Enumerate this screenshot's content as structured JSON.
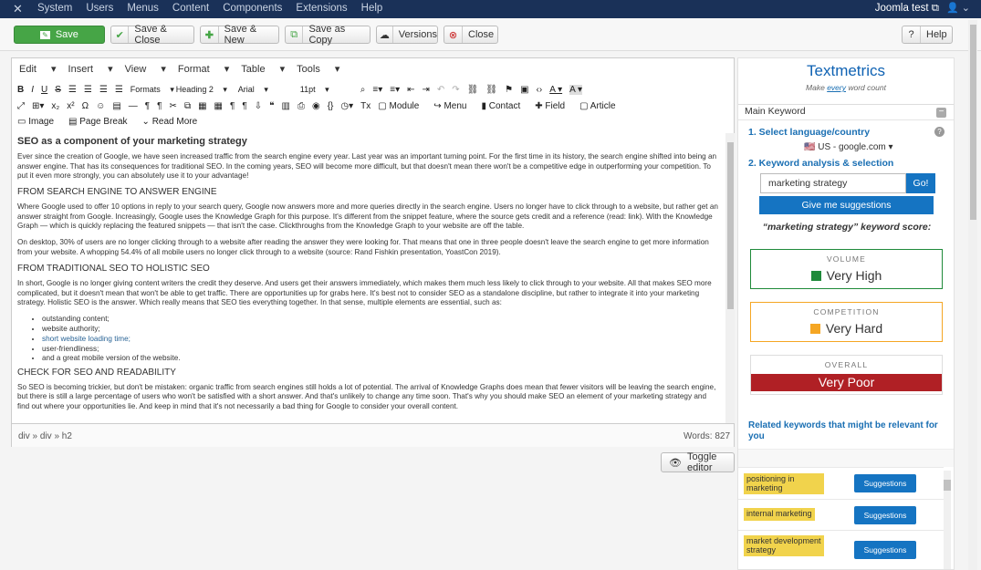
{
  "nav": {
    "items": [
      "System",
      "Users",
      "Menus",
      "Content",
      "Components",
      "Extensions",
      "Help"
    ],
    "site": "Joomla test ⧉",
    "user": "👤 ⌄"
  },
  "toolbar": {
    "save": "Save",
    "save_close": "Save & Close",
    "save_new": "Save & New",
    "save_copy": "Save as Copy",
    "versions": "Versions",
    "close": "Close",
    "help": "Help"
  },
  "editor": {
    "menus": [
      "Edit",
      "Insert",
      "View",
      "Format",
      "Table",
      "Tools"
    ],
    "formats": "Formats",
    "heading": "Heading 2",
    "font": "Arial",
    "size": "11pt",
    "btn_module": "Module",
    "btn_menu": "Menu",
    "btn_contact": "Contact",
    "btn_field": "Field",
    "btn_article": "Article",
    "btn_image": "Image",
    "btn_pagebreak": "Page Break",
    "btn_readmore": "Read More",
    "title": "SEO as a component of your marketing strategy",
    "p1": "Ever since the creation of Google, we have seen increased traffic from the search engine every year. Last year was an important turning point. For the first time in its history, the search engine shifted into being an answer engine. That has its consequences for traditional SEO. In the coming years, SEO will become more difficult, but that doesn't mean there won't be a competitive edge in outperforming your competition. To put it even more strongly, you can absolutely use it to your advantage!",
    "h1": "FROM SEARCH ENGINE TO ANSWER ENGINE",
    "p2": "Where Google used to offer 10 options in reply to your search query, Google now answers more and more queries directly in the search engine. Users no longer have to click through to a website, but rather get an answer straight from Google. Increasingly, Google uses the Knowledge Graph for this purpose. It's different from the snippet feature, where the source gets credit and a reference (read: link). With the Knowledge Graph — which is quickly replacing the featured snippets — that isn't the case. Clickthroughs from the Knowledge Graph to your website are off the table.",
    "p3": "On desktop, 30% of users are no longer clicking through to a website after reading the answer they were looking for. That means that one in three people doesn't leave the search engine to get more information from your website. A whopping 54.4% of all mobile users no longer click through to a website (source: Rand Fishkin presentation, YoastCon 2019).",
    "h2": "FROM TRADITIONAL SEO TO HOLISTIC SEO",
    "p4": "In short, Google is no longer giving content writers the credit they deserve. And users get their answers immediately, which makes them much less likely to click through to your website. All that makes SEO more complicated, but it doesn't mean that won't be able to get traffic. There are opportunities up for grabs here. It's best not to consider SEO as a standalone discipline, but rather to integrate it into your marketing strategy. Holistic SEO is the answer. Which really means that SEO ties everything together. In that sense, multiple elements are essential, such as:",
    "list": [
      "outstanding content;",
      "website authority;",
      "short website loading time;",
      "user-friendliness;",
      "and a great mobile version of the website."
    ],
    "h3": "CHECK FOR SEO AND READABILITY",
    "p5": "So SEO is becoming trickier, but don't be mistaken: organic traffic from search engines still holds a lot of potential. The arrival of Knowledge Graphs does mean that fewer visitors will be leaving the search engine, but there is still a large percentage of users who won't be satisfied with a short answer. And that's unlikely to change any time soon. That's why you should make SEO an element of your marketing strategy and find out where your opportunities lie. And keep in mind that it's not necessarily a bad thing for Google to consider your overall content.",
    "path": "div » div » h2",
    "words": "Words: 827",
    "toggle": "Toggle editor"
  },
  "textmetrics": {
    "logo": "Textmetrics",
    "tag_pre": "Make ",
    "tag_link": "every",
    "tag_post": " word count",
    "section": "Main Keyword",
    "step1": "1. Select language/country",
    "country": "🇺🇸 US - google.com ▾",
    "step2": "2. Keyword analysis & selection",
    "keyword": "marketing strategy",
    "go": "Go!",
    "suggest": "Give me suggestions",
    "score_label": "“marketing strategy” keyword score:",
    "volume_label": "VOLUME",
    "volume_value": "Very High",
    "volume_color": "#1f8a3a",
    "competition_label": "COMPETITION",
    "competition_value": "Very Hard",
    "competition_color": "#f5a623",
    "overall_label": "OVERALL",
    "overall_value": "Very Poor",
    "overall_color": "#b02025",
    "related": "Related keywords that might be relevant for you",
    "keywords": [
      {
        "text": "positioning in marketing",
        "btn": "Suggestions"
      },
      {
        "text": "internal marketing",
        "btn": "Suggestions"
      },
      {
        "text": "market development strategy",
        "btn": "Suggestions"
      }
    ]
  }
}
